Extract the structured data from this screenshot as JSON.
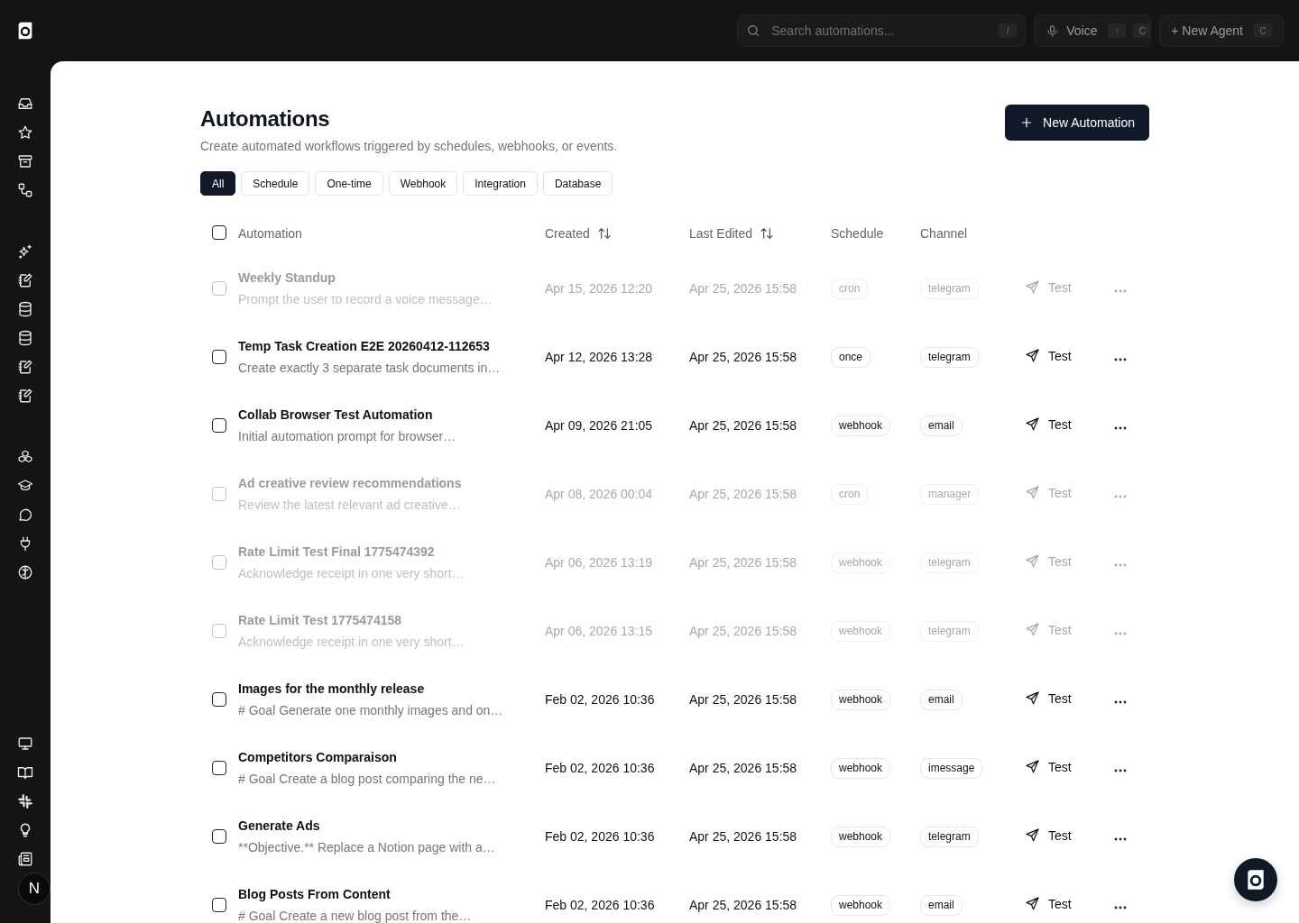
{
  "topbar": {
    "search": {
      "placeholder": "Search automations...",
      "shortcut": "/"
    },
    "voice": {
      "label": "Voice",
      "keys": [
        "↑",
        "C"
      ]
    },
    "new_agent": {
      "label": "+ New Agent",
      "keys": [
        "C"
      ]
    }
  },
  "sidebar": {
    "avatar": "N"
  },
  "page": {
    "title": "Automations",
    "subtitle": "Create automated workflows triggered by schedules, webhooks, or events.",
    "new_button": "New Automation",
    "filters": [
      {
        "label": "All",
        "selected": true
      },
      {
        "label": "Schedule",
        "selected": false
      },
      {
        "label": "One-time",
        "selected": false
      },
      {
        "label": "Webhook",
        "selected": false
      },
      {
        "label": "Integration",
        "selected": false
      },
      {
        "label": "Database",
        "selected": false
      }
    ]
  },
  "table": {
    "select_all_checked": false,
    "columns": [
      {
        "label": "Automation",
        "sortable": false
      },
      {
        "label": "Created",
        "sortable": true
      },
      {
        "label": "Last Edited",
        "sortable": true
      },
      {
        "label": "Schedule",
        "sortable": false
      },
      {
        "label": "Channel",
        "sortable": false
      }
    ],
    "rows": [
      {
        "name": "Weekly Standup",
        "description": "Prompt the user to record a voice message…",
        "created": "Apr 15, 2026 12:20",
        "last_edited": "Apr 25, 2026 15:58",
        "schedule": "cron",
        "channel": "telegram",
        "action": "Test",
        "disabled": true,
        "checked": false
      },
      {
        "name": "Temp Task Creation E2E 20260412-112653",
        "description": "Create exactly 3 separate task documents in…",
        "created": "Apr 12, 2026 13:28",
        "last_edited": "Apr 25, 2026 15:58",
        "schedule": "once",
        "channel": "telegram",
        "action": "Test",
        "disabled": false,
        "checked": false
      },
      {
        "name": "Collab Browser Test Automation",
        "description": "Initial automation prompt for browser…",
        "created": "Apr 09, 2026 21:05",
        "last_edited": "Apr 25, 2026 15:58",
        "schedule": "webhook",
        "channel": "email",
        "action": "Test",
        "disabled": false,
        "checked": false
      },
      {
        "name": "Ad creative review recommendations",
        "description": "Review the latest relevant ad creative…",
        "created": "Apr 08, 2026 00:04",
        "last_edited": "Apr 25, 2026 15:58",
        "schedule": "cron",
        "channel": "manager",
        "action": "Test",
        "disabled": true,
        "checked": false
      },
      {
        "name": "Rate Limit Test Final 1775474392",
        "description": "Acknowledge receipt in one very short…",
        "created": "Apr 06, 2026 13:19",
        "last_edited": "Apr 25, 2026 15:58",
        "schedule": "webhook",
        "channel": "telegram",
        "action": "Test",
        "disabled": true,
        "checked": false
      },
      {
        "name": "Rate Limit Test 1775474158",
        "description": "Acknowledge receipt in one very short…",
        "created": "Apr 06, 2026 13:15",
        "last_edited": "Apr 25, 2026 15:58",
        "schedule": "webhook",
        "channel": "telegram",
        "action": "Test",
        "disabled": true,
        "checked": false
      },
      {
        "name": "Images for the monthly release",
        "description": "# Goal Generate one monthly images and on…",
        "created": "Feb 02, 2026 10:36",
        "last_edited": "Apr 25, 2026 15:58",
        "schedule": "webhook",
        "channel": "email",
        "action": "Test",
        "disabled": false,
        "checked": false
      },
      {
        "name": "Competitors Comparaison",
        "description": "# Goal Create a blog post comparing the ne…",
        "created": "Feb 02, 2026 10:36",
        "last_edited": "Apr 25, 2026 15:58",
        "schedule": "webhook",
        "channel": "imessage",
        "action": "Test",
        "disabled": false,
        "checked": false
      },
      {
        "name": "Generate Ads",
        "description": "**Objective.** Replace a Notion page with a…",
        "created": "Feb 02, 2026 10:36",
        "last_edited": "Apr 25, 2026 15:58",
        "schedule": "webhook",
        "channel": "telegram",
        "action": "Test",
        "disabled": false,
        "checked": false
      },
      {
        "name": "Blog Posts From Content",
        "description": "# Goal Create a new blog post from the…",
        "created": "Feb 02, 2026 10:36",
        "last_edited": "Apr 25, 2026 15:58",
        "schedule": "webhook",
        "channel": "email",
        "action": "Test",
        "disabled": false,
        "checked": false
      }
    ]
  }
}
